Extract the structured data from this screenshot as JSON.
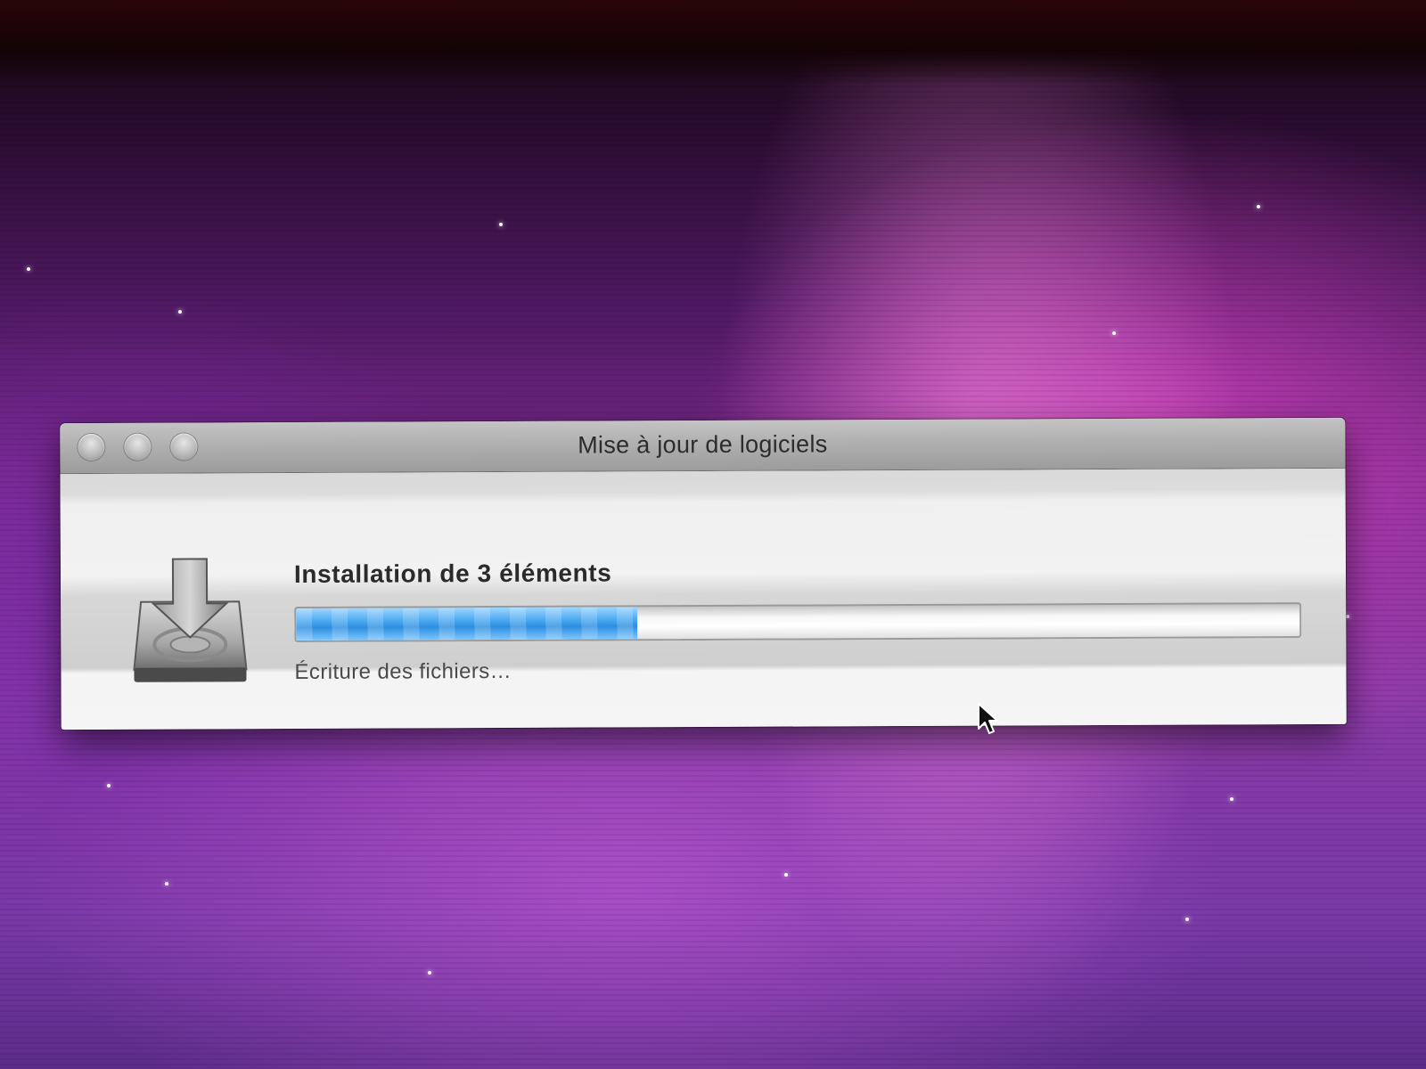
{
  "window": {
    "title": "Mise à jour de logiciels",
    "controls": [
      "close-button",
      "minimize-button",
      "zoom-button"
    ]
  },
  "installer": {
    "icon": "installer-drive-download-icon",
    "heading": "Installation de 3 éléments",
    "progress_fraction": 0.34,
    "progress_color": "#4aa8f0",
    "detail": "Écriture des fichiers…"
  },
  "desktop": {
    "wallpaper": "aurora-purple-pink-starfield",
    "cursor_icon": "arrow-pointer-icon"
  }
}
